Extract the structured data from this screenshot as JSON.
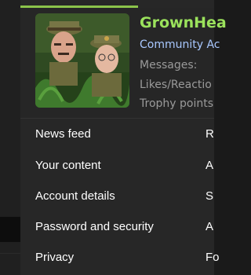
{
  "profile": {
    "username": "GrownHea",
    "role": "Community Ac",
    "stats": [
      {
        "label": "Messages:"
      },
      {
        "label": "Likes/Reactio"
      },
      {
        "label": "Trophy points"
      }
    ]
  },
  "menu": {
    "left_items": [
      {
        "label": "News feed"
      },
      {
        "label": "Your content"
      },
      {
        "label": "Account details"
      },
      {
        "label": "Password and security"
      },
      {
        "label": "Privacy"
      }
    ],
    "right_items": [
      {
        "label": "R"
      },
      {
        "label": "A"
      },
      {
        "label": "S"
      },
      {
        "label": "A"
      },
      {
        "label": "Fo"
      }
    ]
  },
  "colors": {
    "accent": "#8bc34a",
    "username": "#9be25c",
    "role": "#a9c8ff",
    "menu_bg": "#272727"
  }
}
